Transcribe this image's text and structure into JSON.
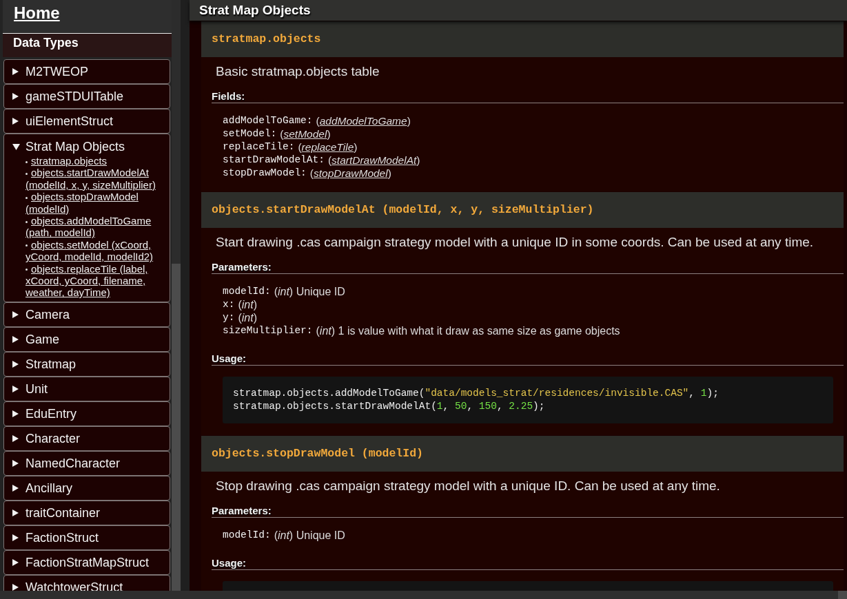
{
  "sidebar": {
    "home_link": "Home",
    "section_title": "Data Types",
    "items": [
      {
        "label": "M2TWEOP",
        "expanded": false
      },
      {
        "label": "gameSTDUITable",
        "expanded": false
      },
      {
        "label": "uiElementStruct",
        "expanded": false
      },
      {
        "label": "Strat Map Objects",
        "expanded": true,
        "children": [
          {
            "label": "stratmap.objects"
          },
          {
            "label": "objects.startDrawModelAt (modelId, x, y, sizeMultiplier)"
          },
          {
            "label": "objects.stopDrawModel (modelId)"
          },
          {
            "label": "objects.addModelToGame (path, modelId)"
          },
          {
            "label": "objects.setModel (xCoord, yCoord, modelId, modelId2)"
          },
          {
            "label": "objects.replaceTile (label, xCoord, yCoord, filename, weather, dayTime)"
          }
        ]
      },
      {
        "label": "Camera",
        "expanded": false
      },
      {
        "label": "Game",
        "expanded": false
      },
      {
        "label": "Stratmap",
        "expanded": false
      },
      {
        "label": "Unit",
        "expanded": false
      },
      {
        "label": "EduEntry",
        "expanded": false
      },
      {
        "label": "Character",
        "expanded": false
      },
      {
        "label": "NamedCharacter",
        "expanded": false
      },
      {
        "label": "Ancillary",
        "expanded": false
      },
      {
        "label": "traitContainer",
        "expanded": false
      },
      {
        "label": "FactionStruct",
        "expanded": false
      },
      {
        "label": "FactionStratMapStruct",
        "expanded": false
      },
      {
        "label": "WatchtowerStruct",
        "expanded": false
      }
    ]
  },
  "page": {
    "title": "Strat Map Objects",
    "sections": [
      {
        "title": "stratmap.objects",
        "description": "Basic stratmap.objects table",
        "blocks": [
          {
            "kind": "fields",
            "label": "Fields:",
            "items": [
              {
                "name": "addModelToGame:",
                "type": "(*addModelToGame*)"
              },
              {
                "name": "setModel:",
                "type": "(*setModel*)"
              },
              {
                "name": "replaceTile:",
                "type": "(*replaceTile*)"
              },
              {
                "name": "startDrawModelAt:",
                "type": "(*startDrawModelAt*)"
              },
              {
                "name": "stopDrawModel:",
                "type": "(*stopDrawModel*)"
              }
            ]
          }
        ]
      },
      {
        "title": "objects.startDrawModelAt (modelId, x, y, sizeMultiplier)",
        "description": "Start drawing .cas campaign strategy model with a unique ID in some coords. Can be used at any time.",
        "blocks": [
          {
            "kind": "parameters",
            "label": "Parameters:",
            "items": [
              {
                "name": "modelId:",
                "description": "(*int*) Unique ID"
              },
              {
                "name": "x:",
                "description": "(*int*)"
              },
              {
                "name": "y:",
                "description": "(*int*)"
              },
              {
                "name": "sizeMultiplier:",
                "description": "(*int*) 1 is value with what it draw as same size as game objects"
              }
            ]
          },
          {
            "kind": "usage",
            "label": "Usage:",
            "lines": [
              {
                "tokens": [
                  {
                    "kind": "plain",
                    "text": "stratmap.objects.addModelToGame("
                  },
                  {
                    "kind": "string",
                    "text": "\"data/models_strat/residences/invisible.CAS\""
                  },
                  {
                    "kind": "plain",
                    "text": ", "
                  },
                  {
                    "kind": "number",
                    "text": "1"
                  },
                  {
                    "kind": "plain",
                    "text": ");"
                  }
                ]
              },
              {
                "tokens": [
                  {
                    "kind": "plain",
                    "text": "stratmap.objects.startDrawModelAt("
                  },
                  {
                    "kind": "number",
                    "text": "1"
                  },
                  {
                    "kind": "plain",
                    "text": ", "
                  },
                  {
                    "kind": "number",
                    "text": "50"
                  },
                  {
                    "kind": "plain",
                    "text": ", "
                  },
                  {
                    "kind": "number",
                    "text": "150"
                  },
                  {
                    "kind": "plain",
                    "text": ", "
                  },
                  {
                    "kind": "number",
                    "text": "2.25"
                  },
                  {
                    "kind": "plain",
                    "text": ");"
                  }
                ]
              }
            ]
          }
        ]
      },
      {
        "title": "objects.stopDrawModel (modelId)",
        "description": "Stop drawing .cas campaign strategy model with a unique ID. Can be used at any time.",
        "blocks": [
          {
            "kind": "parameters",
            "label": "Parameters:",
            "items": [
              {
                "name": "modelId:",
                "description": "(*int*) Unique ID"
              }
            ]
          },
          {
            "kind": "usage",
            "label": "Usage:"
          }
        ]
      }
    ]
  }
}
